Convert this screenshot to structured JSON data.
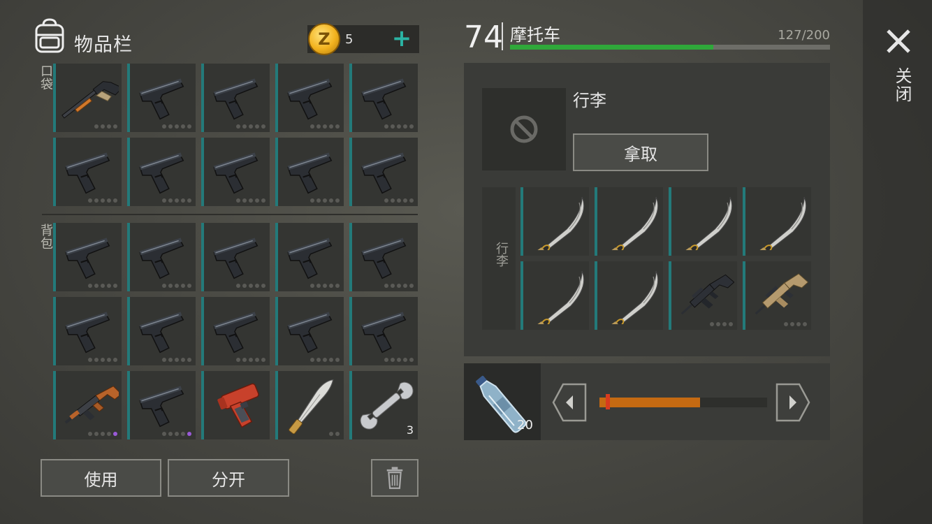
{
  "inventory": {
    "title": "物品栏",
    "currency": {
      "icon": "z-coin-icon",
      "letter": "Z",
      "count": "5"
    },
    "pocket_label": "口袋",
    "backpack_label": "背包",
    "pocket_slots": [
      {
        "item": "shotgun-icon",
        "dots": 4
      },
      {
        "item": "pistol-icon",
        "dots": 5
      },
      {
        "item": "pistol-icon",
        "dots": 5
      },
      {
        "item": "pistol-icon",
        "dots": 5
      },
      {
        "item": "pistol-icon",
        "dots": 5
      },
      {
        "item": "pistol-icon",
        "dots": 5
      },
      {
        "item": "pistol-icon",
        "dots": 5
      },
      {
        "item": "pistol-icon",
        "dots": 5
      },
      {
        "item": "pistol-icon",
        "dots": 5
      },
      {
        "item": "pistol-icon",
        "dots": 5
      }
    ],
    "backpack_slots": [
      {
        "item": "pistol-icon",
        "dots": 5
      },
      {
        "item": "pistol-icon",
        "dots": 5
      },
      {
        "item": "pistol-icon",
        "dots": 5
      },
      {
        "item": "pistol-icon",
        "dots": 5
      },
      {
        "item": "pistol-icon",
        "dots": 5
      },
      {
        "item": "pistol-icon",
        "dots": 5
      },
      {
        "item": "pistol-icon",
        "dots": 5
      },
      {
        "item": "pistol-icon",
        "dots": 5
      },
      {
        "item": "pistol-icon",
        "dots": 5
      },
      {
        "item": "pistol-icon",
        "dots": 5
      },
      {
        "item": "ak47-icon",
        "dots": 5,
        "purple": true
      },
      {
        "item": "pistol-icon",
        "dots": 5,
        "purple": true
      },
      {
        "item": "flare-gun-icon",
        "dots": 0
      },
      {
        "item": "machete-icon",
        "dots": 2
      },
      {
        "item": "wrench-icon",
        "dots": 0,
        "count": "3"
      }
    ],
    "buttons": {
      "use": "使用",
      "split": "分开"
    }
  },
  "vehicle": {
    "level": "74",
    "name": "摩托车",
    "capacity": "127/200",
    "capacity_fraction": 0.635,
    "bag_name": "行李",
    "take_label": "拿取",
    "bag_vertical_label": "行李",
    "slots": [
      {
        "item": "katana-icon",
        "dots": 0
      },
      {
        "item": "katana-icon",
        "dots": 0
      },
      {
        "item": "katana-icon",
        "dots": 0
      },
      {
        "item": "katana-icon",
        "dots": 0
      },
      {
        "item": "katana-icon",
        "dots": 0
      },
      {
        "item": "katana-icon",
        "dots": 0
      },
      {
        "item": "m16-icon",
        "dots": 4
      },
      {
        "item": "scar-icon",
        "dots": 4
      }
    ]
  },
  "fuel": {
    "item": "water-bottle-icon",
    "count": "20",
    "amount_fraction": 0.6
  },
  "close_label": "关闭",
  "colors": {
    "accent": "#237a7a",
    "progress_green": "#2fa83a",
    "slider_orange": "#c56a12",
    "plus_teal": "#2bb3a3"
  }
}
